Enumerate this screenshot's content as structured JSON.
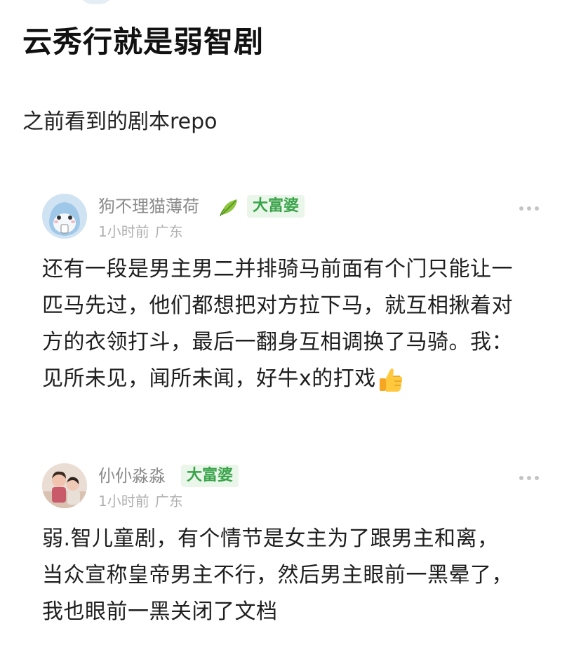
{
  "post": {
    "title": "云秀行就是弱智剧",
    "subtitle": "之前看到的剧本repo"
  },
  "comments": [
    {
      "username": "狗不理猫薄荷",
      "badge": "大富婆",
      "time": "1小时前",
      "location": "广东",
      "avatar_icon": "cartoon-avatar-icon",
      "lines": [
        "还有一段是男主男二并排骑马前面有个门只能让一",
        "匹马先过，他们都想把对方拉下马，就互相揪着对",
        "方的衣领打斗，最后一翻身互相调换了马骑。我：",
        "见所未见，闻所未闻，好牛x的打戏"
      ]
    },
    {
      "username": "仦仦淼淼",
      "badge": "大富婆",
      "time": "1小时前",
      "location": "广东",
      "avatar_icon": "photo-avatar-icon",
      "lines": [
        "弱.智儿童剧，有个情节是女主为了跟男主和离，",
        "当众宣称皇帝男主不行，然后男主眼前一黑晕了，",
        "我也眼前一黑关闭了文档"
      ]
    }
  ],
  "colors": {
    "badge_text": "#3aa44a",
    "badge_bg": "#eaf6ea",
    "meta_text": "#b0b0b0",
    "username_text": "#8a8a8a"
  }
}
